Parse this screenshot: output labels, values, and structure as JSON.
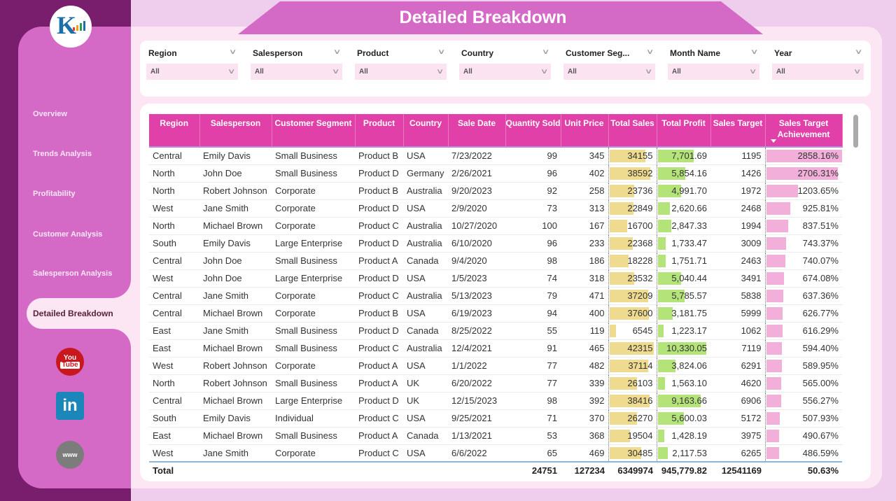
{
  "title": "Detailed Breakdown",
  "sidebar": {
    "items": [
      {
        "label": "Overview"
      },
      {
        "label": "Trends Analysis"
      },
      {
        "label": "Profitability"
      },
      {
        "label": "Customer Analysis"
      },
      {
        "label": "Salesperson Analysis"
      },
      {
        "label": "Detailed Breakdown",
        "active": true
      }
    ],
    "social": {
      "youtube_top": "You",
      "youtube_bottom": "Tube",
      "linkedin": "in",
      "web": "www"
    }
  },
  "filters": [
    {
      "label": "Region",
      "value": "All"
    },
    {
      "label": "Salesperson",
      "value": "All"
    },
    {
      "label": "Product",
      "value": "All"
    },
    {
      "label": "Country",
      "value": "All"
    },
    {
      "label": "Customer Seg...",
      "value": "All"
    },
    {
      "label": "Month Name",
      "value": "All"
    },
    {
      "label": "Year",
      "value": "All"
    }
  ],
  "table": {
    "columns": [
      "Region",
      "Salesperson",
      "Customer Segment",
      "Product",
      "Country",
      "Sale Date",
      "Quantity Sold",
      "Unit Price",
      "Total Sales",
      "Total Profit",
      "Sales Target",
      "Sales Target Achievement"
    ],
    "sorted_column": "Sales Target Achievement",
    "colors": {
      "header": "#e040a8",
      "sales_bar": "#eedb8f",
      "profit_bar": "#b4e37a",
      "achievement_bar": "#f2afda"
    },
    "rows": [
      [
        "Central",
        "Emily Davis",
        "Small Business",
        "Product B",
        "USA",
        "7/23/2022",
        "99",
        "345",
        "34155",
        "7,701.69",
        "1195",
        "2858.16%"
      ],
      [
        "North",
        "John Doe",
        "Small Business",
        "Product D",
        "Germany",
        "2/26/2021",
        "96",
        "402",
        "38592",
        "5,854.16",
        "1426",
        "2706.31%"
      ],
      [
        "North",
        "Robert Johnson",
        "Corporate",
        "Product B",
        "Australia",
        "9/20/2023",
        "92",
        "258",
        "23736",
        "4,991.70",
        "1972",
        "1203.65%"
      ],
      [
        "West",
        "Jane Smith",
        "Corporate",
        "Product D",
        "USA",
        "2/9/2020",
        "73",
        "313",
        "22849",
        "2,620.66",
        "2468",
        "925.81%"
      ],
      [
        "North",
        "Michael Brown",
        "Corporate",
        "Product C",
        "Australia",
        "10/27/2020",
        "100",
        "167",
        "16700",
        "2,847.33",
        "1994",
        "837.51%"
      ],
      [
        "South",
        "Emily Davis",
        "Large Enterprise",
        "Product D",
        "Australia",
        "6/10/2020",
        "96",
        "233",
        "22368",
        "1,733.47",
        "3009",
        "743.37%"
      ],
      [
        "Central",
        "John Doe",
        "Small Business",
        "Product A",
        "Canada",
        "9/4/2020",
        "98",
        "186",
        "18228",
        "1,751.71",
        "2463",
        "740.07%"
      ],
      [
        "West",
        "John Doe",
        "Large Enterprise",
        "Product D",
        "USA",
        "1/5/2023",
        "74",
        "318",
        "23532",
        "5,040.44",
        "3491",
        "674.08%"
      ],
      [
        "Central",
        "Jane Smith",
        "Corporate",
        "Product C",
        "Australia",
        "5/13/2023",
        "79",
        "471",
        "37209",
        "5,785.57",
        "5838",
        "637.36%"
      ],
      [
        "Central",
        "Michael Brown",
        "Corporate",
        "Product B",
        "USA",
        "6/19/2023",
        "94",
        "400",
        "37600",
        "3,181.75",
        "5999",
        "626.77%"
      ],
      [
        "East",
        "Jane Smith",
        "Small Business",
        "Product D",
        "Canada",
        "8/25/2022",
        "55",
        "119",
        "6545",
        "1,223.17",
        "1062",
        "616.29%"
      ],
      [
        "East",
        "Michael Brown",
        "Small Business",
        "Product C",
        "Australia",
        "12/4/2021",
        "91",
        "465",
        "42315",
        "10,330.05",
        "7119",
        "594.40%"
      ],
      [
        "West",
        "Robert Johnson",
        "Corporate",
        "Product A",
        "USA",
        "1/1/2022",
        "77",
        "482",
        "37114",
        "3,824.06",
        "6291",
        "589.95%"
      ],
      [
        "North",
        "Robert Johnson",
        "Small Business",
        "Product A",
        "UK",
        "6/20/2022",
        "77",
        "339",
        "26103",
        "1,563.10",
        "4620",
        "565.00%"
      ],
      [
        "Central",
        "Michael Brown",
        "Large Enterprise",
        "Product D",
        "UK",
        "12/15/2023",
        "98",
        "392",
        "38416",
        "9,163.66",
        "6906",
        "556.27%"
      ],
      [
        "South",
        "Emily Davis",
        "Individual",
        "Product C",
        "USA",
        "9/25/2021",
        "71",
        "370",
        "26270",
        "5,600.03",
        "5172",
        "507.93%"
      ],
      [
        "East",
        "Michael Brown",
        "Small Business",
        "Product A",
        "Canada",
        "1/13/2021",
        "53",
        "368",
        "19504",
        "1,428.19",
        "3975",
        "490.67%"
      ],
      [
        "West",
        "Jane Smith",
        "Corporate",
        "Product C",
        "USA",
        "6/6/2022",
        "65",
        "469",
        "30485",
        "2,117.53",
        "6265",
        "486.59%"
      ]
    ],
    "total": {
      "label": "Total",
      "quantity": "24751",
      "unit_price": "127234",
      "total_sales": "6349974",
      "total_profit": "945,779.82",
      "sales_target": "12541169",
      "achievement": "50.63%"
    }
  }
}
